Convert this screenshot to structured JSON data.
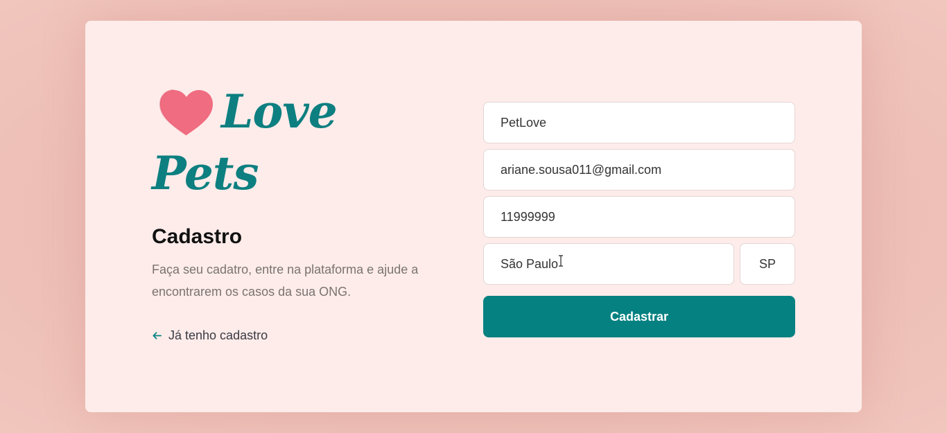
{
  "logo": {
    "word1": "Love",
    "word2": "Pets",
    "heart_icon": "heart-icon",
    "heart_color": "#f06c80",
    "text_color": "#0d7f80"
  },
  "page": {
    "title": "Cadastro",
    "description": "Faça seu cadatro, entre na plataforma e ajude a encontrarem os casos da sua ONG.",
    "back_link": "Já tenho cadastro",
    "back_icon": "arrow-left-icon"
  },
  "form": {
    "name": "PetLove",
    "email": "ariane.sousa011@gmail.com",
    "whatsapp": "11999999",
    "city": "São Paulo",
    "uf": "SP",
    "submit": "Cadastrar"
  },
  "colors": {
    "accent": "#058181",
    "card_bg": "#fdecea",
    "page_bg": "#ecbdb5"
  }
}
